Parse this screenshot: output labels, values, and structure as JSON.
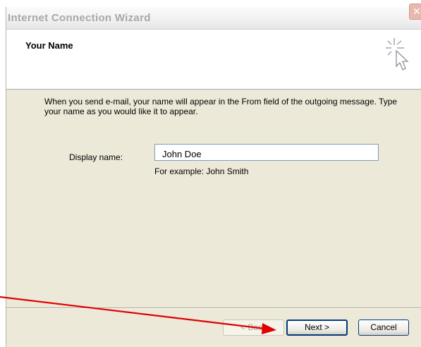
{
  "window": {
    "title": "Internet Connection Wizard",
    "close_glyph": "✕"
  },
  "header": {
    "title": "Your Name",
    "icon": "wizard-cursor-icon"
  },
  "content": {
    "instructions": "When you send e-mail, your name will appear in the From field of the outgoing message. Type your name as you would like it to appear.",
    "display_name_label": "Display name:",
    "display_name_value": "John Doe",
    "example_text": "For example: John Smith"
  },
  "buttons": {
    "back_label": "< Back",
    "next_label": "Next >",
    "cancel_label": "Cancel"
  },
  "annotation": {
    "arrow_color": "#e00000"
  }
}
